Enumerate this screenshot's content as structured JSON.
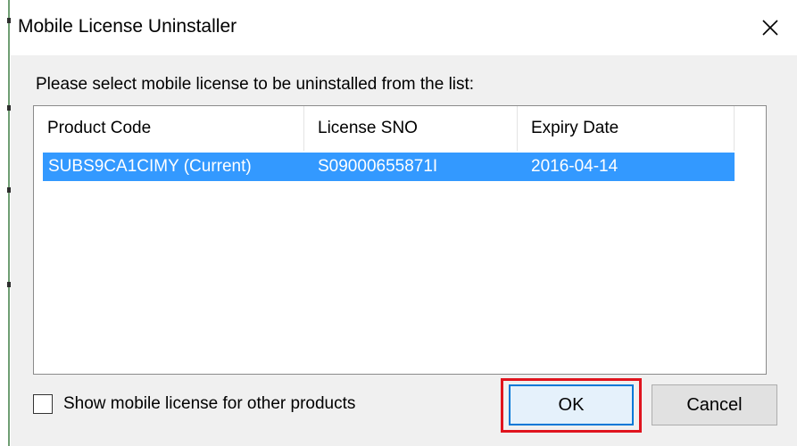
{
  "window": {
    "title": "Mobile License Uninstaller",
    "close_glyph": "✕"
  },
  "prompt": "Please select mobile license to be uninstalled from the list:",
  "list": {
    "columns": [
      "Product Code",
      "License SNO",
      "Expiry Date"
    ],
    "rows": [
      {
        "product_code": "SUBS9CA1CIMY (Current)",
        "license_sno": "S09000655871I",
        "expiry_date": "2016-04-14",
        "selected": true
      }
    ]
  },
  "checkbox": {
    "label": "Show mobile license for other products",
    "checked": false
  },
  "buttons": {
    "ok": "OK",
    "cancel": "Cancel"
  },
  "colors": {
    "selection": "#3399ff",
    "highlight_box": "#e0141e",
    "default_button_border": "#0078d7"
  }
}
